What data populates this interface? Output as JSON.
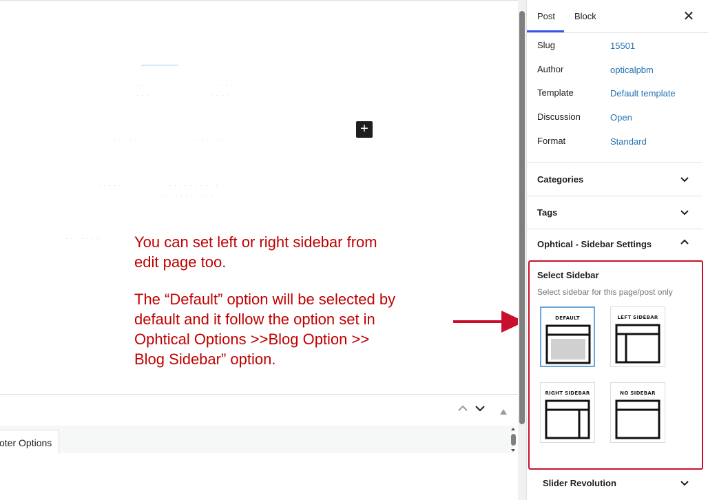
{
  "canvas": {
    "annotation_line1": "You can set left or right sidebar from",
    "annotation_line2": "edit page too.",
    "annotation_line3": "The “Default” option will be selected by",
    "annotation_line4": "default and it follow the option set in",
    "annotation_line5": "Ophtical Options >>Blog Option >>",
    "annotation_line6": "Blog Sidebar” option.",
    "inserter_icon": "plus-icon",
    "footer_tab_label": "oter Options"
  },
  "sidebar": {
    "tabs": [
      {
        "label": "Post",
        "active": true
      },
      {
        "label": "Block",
        "active": false
      }
    ],
    "close_icon": "close-icon",
    "summary": [
      {
        "label": "Slug",
        "value": "15501"
      },
      {
        "label": "Author",
        "value": "opticalpbm"
      },
      {
        "label": "Template",
        "value": "Default template"
      },
      {
        "label": "Discussion",
        "value": "Open"
      },
      {
        "label": "Format",
        "value": "Standard"
      }
    ],
    "panels": {
      "categories": "Categories",
      "tags": "Tags",
      "sidebar_settings": "Ophtical - Sidebar Settings",
      "slider_revolution": "Slider Revolution"
    },
    "select_sidebar": {
      "title": "Select Sidebar",
      "help": "Select sidebar for this page/post only",
      "options": [
        {
          "label": "DEFAULT",
          "selected": true
        },
        {
          "label": "LEFT SIDEBAR",
          "selected": false
        },
        {
          "label": "RIGHT SIDEBAR",
          "selected": false
        },
        {
          "label": "NO SIDEBAR",
          "selected": false
        }
      ]
    }
  },
  "colors": {
    "annotation": "#c00000",
    "highlight_box": "#c8102e",
    "link": "#2271b1",
    "accent": "#3858e9"
  }
}
